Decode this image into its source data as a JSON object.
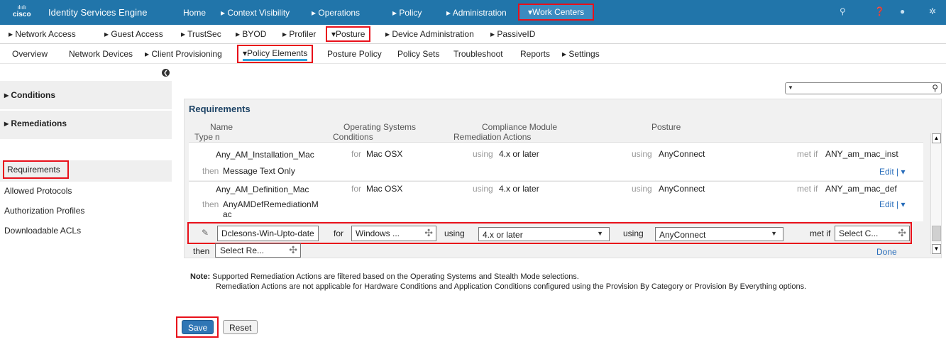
{
  "app": {
    "logo_text": "cisco",
    "logo_bars": "ılıılı",
    "name": "Identity Services Engine"
  },
  "top_nav": {
    "home": "Home",
    "context_visibility": "▸ Context Visibility",
    "operations": "▸ Operations",
    "policy": "▸ Policy",
    "administration": "▸ Administration",
    "work_centers": "▾Work Centers"
  },
  "top_icons": {
    "search": "⚲",
    "help": "❓",
    "info": "●",
    "settings": "✲"
  },
  "sub_nav": {
    "network_access": "▸ Network Access",
    "guest_access": "▸ Guest Access",
    "trustsec": "▸ TrustSec",
    "byod": "▸ BYOD",
    "profiler": "▸ Profiler",
    "posture": "▾Posture",
    "device_administration": "▸ Device Administration",
    "passive_id": "▸ PassiveID"
  },
  "third_nav": {
    "overview": "Overview",
    "network_devices": "Network Devices",
    "client_provisioning": "▸ Client Provisioning",
    "policy_elements": "▾Policy Elements",
    "posture_policy": "Posture Policy",
    "policy_sets": "Policy Sets",
    "troubleshoot": "Troubleshoot",
    "reports": "Reports",
    "settings": "▸ Settings"
  },
  "sidebar": {
    "conditions": "▸ Conditions",
    "remediations": "▸ Remediations",
    "requirements": "Requirements",
    "allowed_protocols": "Allowed Protocols",
    "authorization_profiles": "Authorization Profiles",
    "downloadable_acls": "Downloadable ACLs"
  },
  "panel": {
    "title": "Requirements",
    "columns": {
      "name_line1": "Name",
      "name_line2": "n",
      "type": "Type",
      "os_line1": "Operating Systems",
      "os_line2": "Conditions",
      "compliance_line1": "Compliance Module",
      "compliance_line2": "Remediation Actions",
      "posture": "Posture"
    },
    "rows": [
      {
        "name": "Any_AM_Installation_Mac",
        "for_kw": "for",
        "os": "Mac OSX",
        "using_kw": "using",
        "module": "4.x or later",
        "using_kw2": "using",
        "posture": "AnyConnect",
        "metif_kw": "met if",
        "condition": "ANY_am_mac_inst",
        "then_kw": "then",
        "remediation": "Message Text Only",
        "edit": "Edit | ▾"
      },
      {
        "name": "Any_AM_Definition_Mac",
        "for_kw": "for",
        "os": "Mac OSX",
        "using_kw": "using",
        "module": "4.x or later",
        "using_kw2": "using",
        "posture": "AnyConnect",
        "metif_kw": "met if",
        "condition": "ANY_am_mac_def",
        "then_kw": "then",
        "remediation_line1": "AnyAMDefRemediationM",
        "remediation_line2": "ac",
        "edit": "Edit | ▾"
      }
    ],
    "edit_row": {
      "name_value": "Dclesons-Win-Upto-date",
      "for_label": "for",
      "os_value": "Windows ...",
      "using_label": "using",
      "module_value": "4.x or later",
      "using_label2": "using",
      "posture_value": "AnyConnect",
      "metif_label": "met if",
      "condition_value": "Select C...",
      "then_label": "then",
      "remediation_value": "Select Re...",
      "done": "Done"
    }
  },
  "note": {
    "label": "Note:",
    "line1": "Supported Remediation Actions are filtered based on the Operating Systems and Stealth Mode selections.",
    "line2": "Remediation Actions are not applicable for Hardware Conditions and Application Conditions configured using the Provision By Category or Provision By Everything options."
  },
  "buttons": {
    "save": "Save",
    "reset": "Reset"
  },
  "colors": {
    "topbar": "#2175aa",
    "highlight": "#e8101a",
    "accent": "#2ea3db",
    "save": "#2f76b5"
  }
}
